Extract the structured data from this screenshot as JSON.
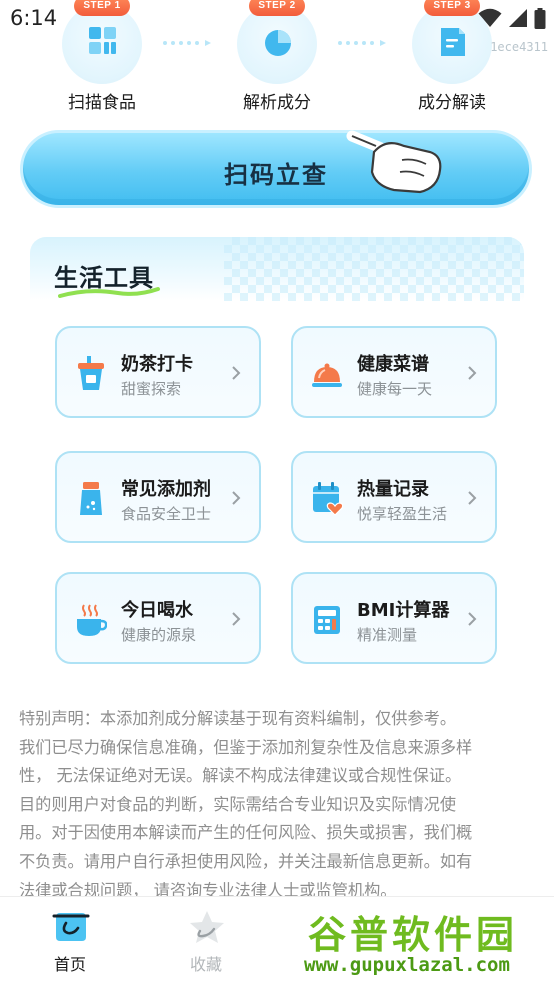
{
  "status_bar": {
    "time": "6:14",
    "build_id": "1ece4311"
  },
  "steps": [
    {
      "badge": "STEP 1",
      "label": "扫描食品",
      "icon": "grid-scan-icon"
    },
    {
      "badge": "STEP 2",
      "label": "解析成分",
      "icon": "pie-chart-icon"
    },
    {
      "badge": "STEP 3",
      "label": "成分解读",
      "icon": "document-icon"
    }
  ],
  "scan": {
    "label": "扫码立查",
    "icon": "pointing-hand-icon"
  },
  "tools": {
    "title": "生活工具",
    "cards": [
      {
        "title": "奶茶打卡",
        "subtitle": "甜蜜探索",
        "icon": "milk-tea-icon"
      },
      {
        "title": "健康菜谱",
        "subtitle": "健康每一天",
        "icon": "food-cloche-icon"
      },
      {
        "title": "常见添加剂",
        "subtitle": "食品安全卫士",
        "icon": "additive-bottle-icon"
      },
      {
        "title": "热量记录",
        "subtitle": "悦享轻盈生活",
        "icon": "calendar-heart-icon"
      },
      {
        "title": "今日喝水",
        "subtitle": "健康的源泉",
        "icon": "hot-cup-icon"
      },
      {
        "title": "BMI计算器",
        "subtitle": "精准测量",
        "icon": "calculator-icon"
      }
    ]
  },
  "disclaimer": {
    "lines": [
      "特别声明：本添加剂成分解读基于现有资料编制，仅供参考。",
      "我们已尽力确保信息准确，但鉴于添加剂复杂性及信息来源多样",
      "性， 无法保证绝对无误。解读不构成法律建议或合规性保证。",
      "目的则用户对食品的判断，实际需结合专业知识及实际情况使",
      "用。对于因使用本解读而产生的任何风险、损失或损害，我们概",
      "不负责。请用户自行承担使用风险，并关注最新信息更新。如有",
      "法律或合规问题， 请咨询专业法律人士或监管机构。"
    ]
  },
  "tabbar": {
    "tabs": [
      {
        "label": "首页",
        "active": true,
        "icon": "home-icon"
      },
      {
        "label": "收藏",
        "active": false,
        "icon": "star-icon"
      }
    ]
  },
  "watermark": {
    "logo": "谷普软件园",
    "url": "www.gupuxlazal.com"
  },
  "colors": {
    "accent_blue": "#4cc3f2",
    "card_border": "#aee2f5",
    "badge_orange": "#f25c3b",
    "icon_blue": "#3ab4ec",
    "icon_orange": "#f47a4a",
    "watermark_green": "#6fbb1f"
  }
}
